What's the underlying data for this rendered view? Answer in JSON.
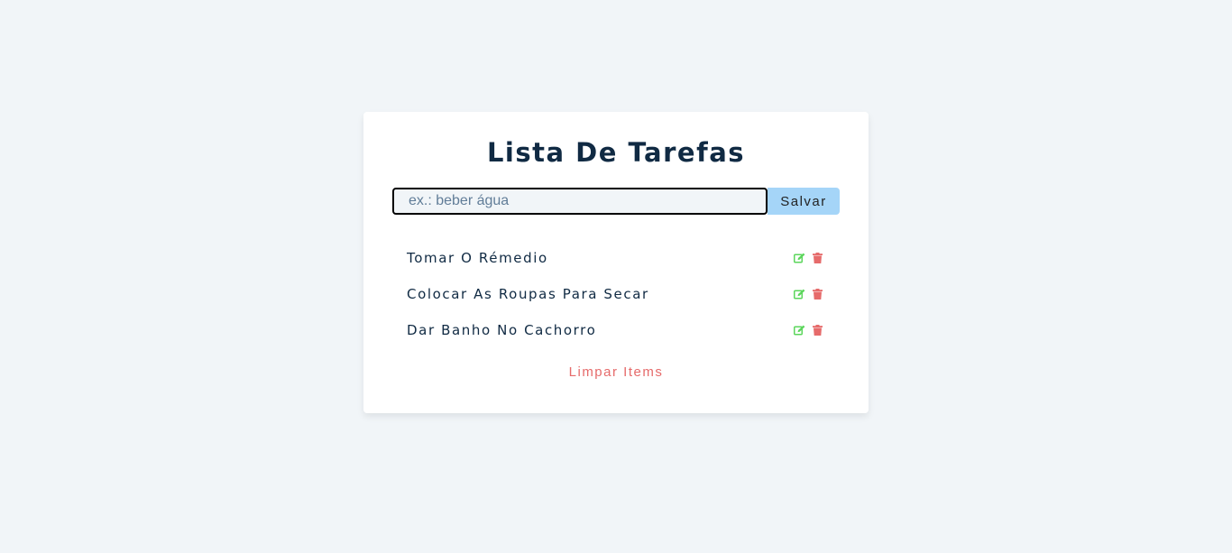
{
  "app": {
    "title": "Lista De Tarefas"
  },
  "form": {
    "input_value": "",
    "input_placeholder": "ex.: beber água",
    "submit_label": "Salvar"
  },
  "items": [
    {
      "title": "Tomar O Rémedio"
    },
    {
      "title": "Colocar As Roupas Para Secar"
    },
    {
      "title": "Dar Banho No Cachorro"
    }
  ],
  "clear_label": "Limpar Items",
  "icons": {
    "edit": "edit-icon",
    "delete": "trash-icon"
  },
  "colors": {
    "background": "#f1f5f8",
    "card": "#ffffff",
    "title": "#102a43",
    "submit_bg": "#a5d5f8",
    "edit": "#5cd65c",
    "delete": "#e66b6b",
    "clear": "#e66b6b"
  }
}
